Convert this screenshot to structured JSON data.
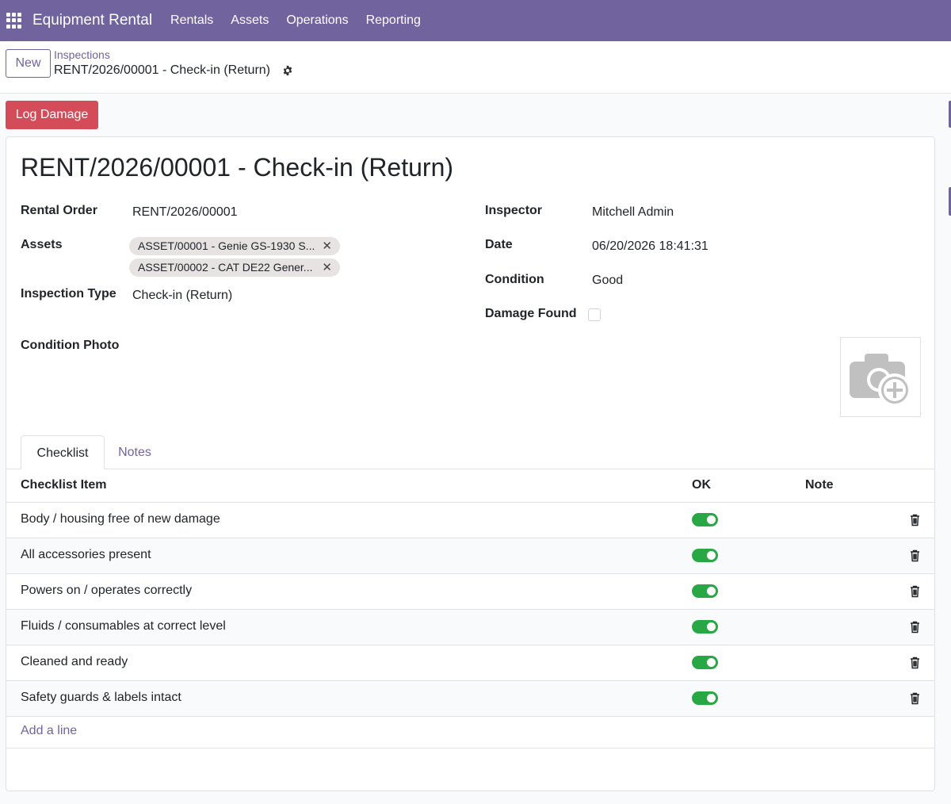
{
  "navbar": {
    "brand": "Equipment Rental",
    "menu": [
      "Rentals",
      "Assets",
      "Operations",
      "Reporting"
    ],
    "bg_color": "#71639e"
  },
  "control_panel": {
    "new_label": "New",
    "breadcrumb_parent": "Inspections",
    "breadcrumb_current": "RENT/2026/00001 - Check-in (Return)"
  },
  "actions": {
    "log_damage": "Log Damage",
    "log_damage_color": "#d44c59"
  },
  "record": {
    "title": "RENT/2026/00001 - Check-in (Return)",
    "rental_order_label": "Rental Order",
    "rental_order": "RENT/2026/00001",
    "assets_label": "Assets",
    "assets": [
      "ASSET/00001 - Genie GS-1930 S...",
      "ASSET/00002 - CAT DE22 Gener..."
    ],
    "inspection_type_label": "Inspection Type",
    "inspection_type": "Check-in (Return)",
    "inspector_label": "Inspector",
    "inspector": "Mitchell Admin",
    "date_label": "Date",
    "date": "06/20/2026 18:41:31",
    "condition_label": "Condition",
    "condition": "Good",
    "damage_found_label": "Damage Found",
    "damage_found": false,
    "condition_photo_label": "Condition Photo"
  },
  "tabs": [
    "Checklist",
    "Notes"
  ],
  "checklist": {
    "headers": {
      "item": "Checklist Item",
      "ok": "OK",
      "note": "Note"
    },
    "rows": [
      {
        "item": "Body / housing free of new damage",
        "ok": true,
        "note": ""
      },
      {
        "item": "All accessories present",
        "ok": true,
        "note": ""
      },
      {
        "item": "Powers on / operates correctly",
        "ok": true,
        "note": ""
      },
      {
        "item": "Fluids / consumables at correct level",
        "ok": true,
        "note": ""
      },
      {
        "item": "Cleaned and ready",
        "ok": true,
        "note": ""
      },
      {
        "item": "Safety guards & labels intact",
        "ok": true,
        "note": ""
      }
    ],
    "add_line": "Add a line",
    "toggle_on_color": "#28a745"
  }
}
